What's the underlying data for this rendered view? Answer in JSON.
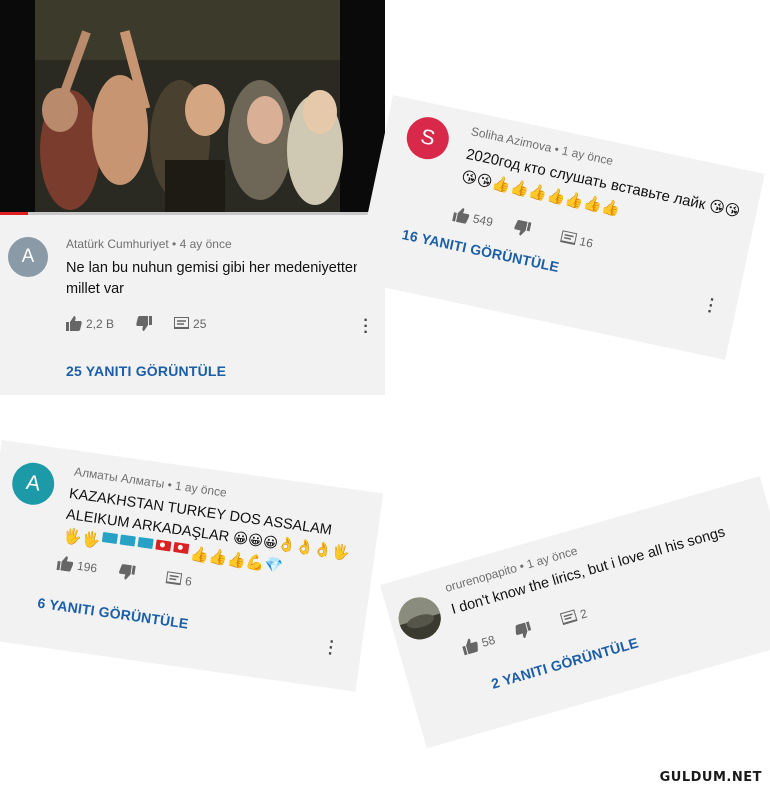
{
  "card1": {
    "avatar_letter": "A",
    "avatar_color": "#8a9aa6",
    "author": "Atatürk Cumhuriyet",
    "time": "• 4 ay önce",
    "text": "Ne lan bu nuhun gemisi gibi her medeniyetten millet var",
    "likes": "2,2 B",
    "comments": "25",
    "replies": "25 YANITI GÖRÜNTÜLE"
  },
  "card2": {
    "avatar_letter": "S",
    "avatar_color": "#d9294a",
    "author": "Soliha Azimova",
    "time": "• 1 ay önce",
    "text_line1": "2020год кто слушать вставьте лайк 😘😘",
    "text_line2": "😘😘👍👍👍👍👍👍👍",
    "likes": "549",
    "comments": "16",
    "replies": "16 YANITI GÖRÜNTÜLE"
  },
  "card3": {
    "avatar_letter": "A",
    "avatar_color": "#1c9aa8",
    "author": "Алматы Алматы",
    "time": "• 1 ay önce",
    "text_line1": "KAZAKHSTAN TURKEY  DOS ASSALAM",
    "text_line2": "ALEIKUM ARKADAŞLAR 😀😀😀👌👌👌🖐",
    "emoji_line_start": "🖐🖐",
    "emoji_line_end": "👍👍👍💪💎",
    "likes": "196",
    "comments": "6",
    "replies": "6 YANITI GÖRÜNTÜLE"
  },
  "card4": {
    "author": "orurenopapito",
    "time": "• 1 ay önce",
    "text": "I don't know the lirics, but i love all his songs",
    "likes": "58",
    "comments": "2",
    "replies": "2 YANITI GÖRÜNTÜLE"
  },
  "watermark": "GULDUM.NET",
  "colors": {
    "link": "#1b5ea8",
    "card_bg": "#f2f2f2"
  }
}
